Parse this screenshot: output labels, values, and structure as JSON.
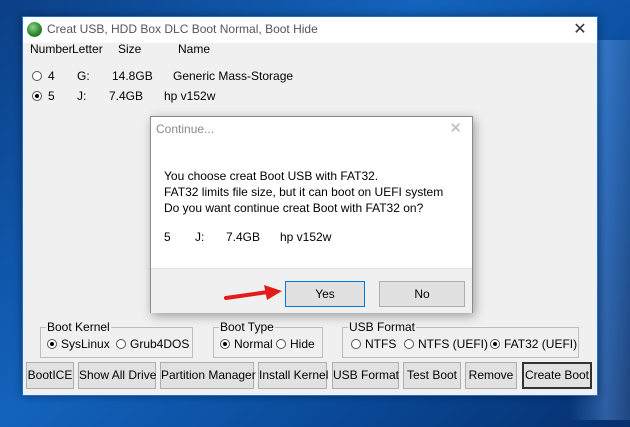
{
  "window": {
    "title": "Creat USB, HDD Box DLC Boot Normal, Boot Hide",
    "close_glyph": "✕"
  },
  "columns": [
    "Number",
    "Letter",
    "Size",
    "Name"
  ],
  "drives": [
    {
      "number": "4",
      "letter": "G:",
      "size": "14.8GB",
      "name": "Generic Mass-Storage",
      "selected": false
    },
    {
      "number": "5",
      "letter": "J:",
      "size": "7.4GB",
      "name": "hp v152w",
      "selected": true
    }
  ],
  "groups": {
    "boot_kernel": {
      "legend": "Boot Kernel",
      "options": [
        "SysLinux",
        "Grub4DOS"
      ],
      "selected": "SysLinux"
    },
    "boot_type": {
      "legend": "Boot Type",
      "options": [
        "Normal",
        "Hide"
      ],
      "selected": "Normal"
    },
    "usb_format": {
      "legend": "USB Format",
      "options": [
        "NTFS",
        "NTFS (UEFI)",
        "FAT32 (UEFI)"
      ],
      "selected": "FAT32 (UEFI)"
    }
  },
  "buttons": [
    "BootICE",
    "Show All Drive",
    "Partition Manager",
    "Install Kernel",
    "USB Format",
    "Test Boot",
    "Remove",
    "Create Boot"
  ],
  "dialog": {
    "title": "Continue...",
    "close_glyph": "✕",
    "message": [
      "You choose creat Boot USB with FAT32.",
      "FAT32 limits file size, but it can boot on UEFI system",
      "Do you want continue creat Boot with FAT32 on?"
    ],
    "info": {
      "number": "5",
      "letter": "J:",
      "size": "7.4GB",
      "name": "hp v152w"
    },
    "yes_label": "Yes",
    "no_label": "No"
  },
  "colors": {
    "accent_border": "#1e6fd0",
    "arrow": "#e31b1b"
  },
  "icons": {
    "app": "app-globe-icon",
    "arrow": "red-arrow-icon"
  }
}
